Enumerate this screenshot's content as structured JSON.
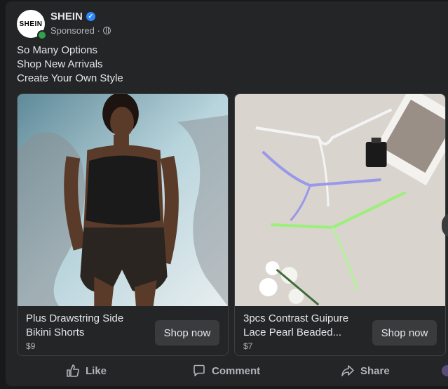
{
  "post": {
    "page_name": "SHEIN",
    "avatar_text": "SHEIN",
    "sponsored": "Sponsored ·",
    "body_lines": [
      "So Many Options",
      "Shop New Arrivals",
      "Create Your Own Style"
    ]
  },
  "cards": [
    {
      "title_line1": "Plus Drawstring Side",
      "title_line2": "Bikini Shorts",
      "price": "$9",
      "cta": "Shop now"
    },
    {
      "title_line1": "3pcs Contrast Guipure",
      "title_line2": "Lace Pearl Beaded...",
      "price": "$7",
      "cta": "Shop now"
    }
  ],
  "actions": {
    "like": "Like",
    "comment": "Comment",
    "share": "Share"
  },
  "colors": {
    "background": "#18191a",
    "card": "#242526",
    "button": "#3a3b3c",
    "verified": "#2d88ff",
    "online": "#31a24c"
  }
}
